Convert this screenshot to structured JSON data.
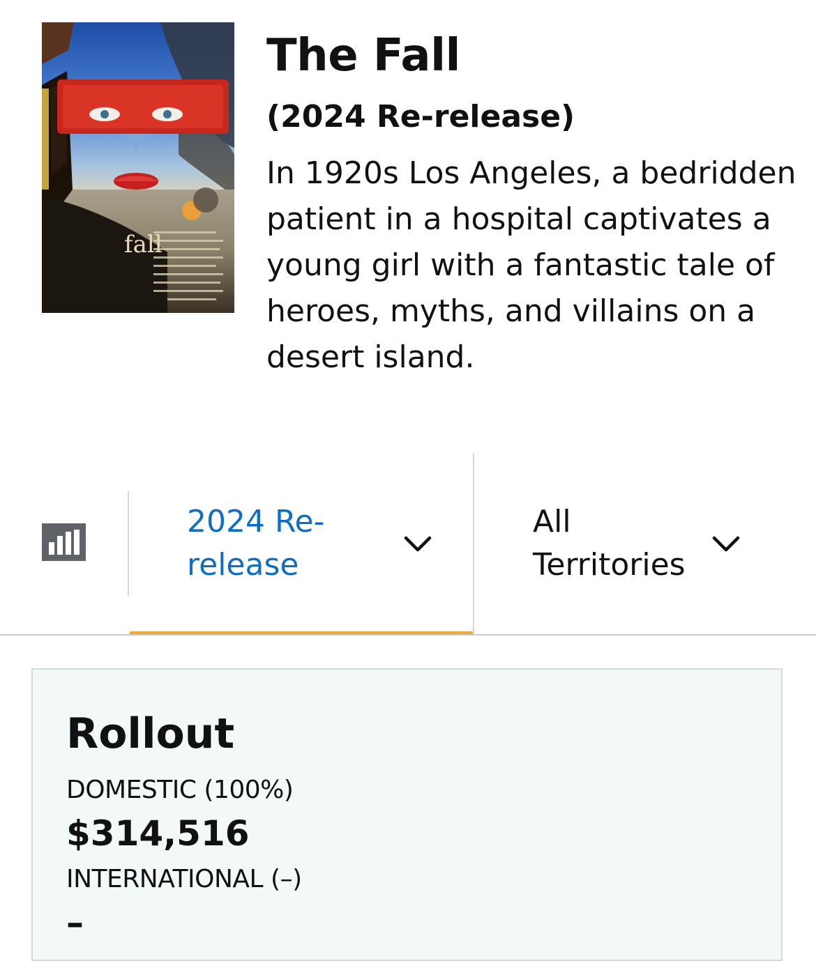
{
  "movie": {
    "title": "The Fall",
    "release_label": "(2024 Re-release)",
    "synopsis": "In 1920s Los Angeles, a bedridden patient in a hospital captivates a young girl with a fantastic tale of heroes, myths, and villains on a desert island.",
    "poster_title_text": "fall"
  },
  "controls": {
    "chart_icon": "bar-chart-icon",
    "release_select": {
      "selected": "2024 Re-release",
      "icon": "chevron-down-icon"
    },
    "territory_select": {
      "selected": "All Territories",
      "icon": "chevron-down-icon"
    }
  },
  "rollout": {
    "title": "Rollout",
    "domestic_label": "DOMESTIC (100%)",
    "domestic_value": "$314,516",
    "international_label": "INTERNATIONAL (–)",
    "international_value": "–"
  },
  "colors": {
    "link_blue": "#0f6ec3",
    "tab_underline": "#f0a93b",
    "chart_icon_bg": "#5f6368",
    "panel_bg": "#f3f8f8"
  }
}
